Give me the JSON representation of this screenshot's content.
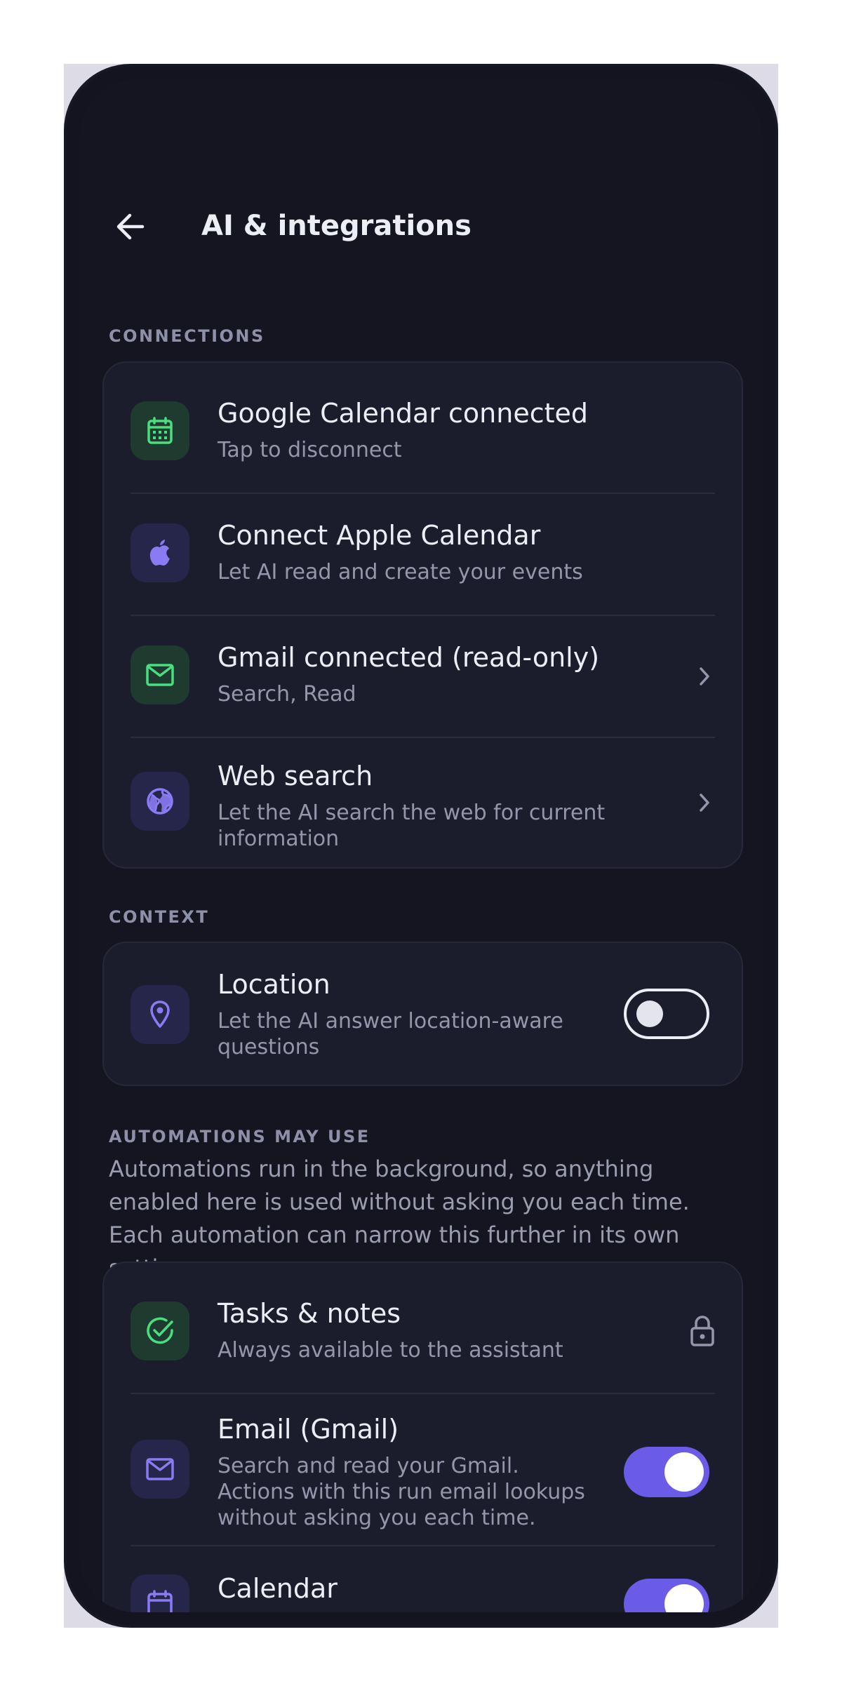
{
  "header": {
    "title": "AI & integrations",
    "back_icon": "arrow-left-icon"
  },
  "sections": {
    "connections": "CONNECTIONS",
    "context": "CONTEXT",
    "automations": "AUTOMATIONS MAY USE"
  },
  "connections": [
    {
      "title": "Google Calendar connected",
      "subtitle": "Tap to disconnect",
      "icon": "calendar-icon"
    },
    {
      "title": "Connect Apple Calendar",
      "subtitle": "Let AI read and create your events",
      "icon": "apple-icon"
    },
    {
      "title": "Gmail connected (read-only)",
      "subtitle": "Search, Read",
      "icon": "mail-icon"
    },
    {
      "title": "Web search",
      "subtitle": "Let the AI search the web for current information",
      "icon": "globe-icon"
    }
  ],
  "context": {
    "title": "Location",
    "subtitle": "Let the AI answer location-aware questions",
    "icon": "location-pin-icon",
    "enabled": false
  },
  "automations_note": "Automations run in the background, so anything enabled here is used without asking you each time. Each automation can narrow this further in its own settings.",
  "automations": [
    {
      "title": "Tasks & notes",
      "subtitle": "Always available to the assistant",
      "icon": "check-circle-icon",
      "locked": true
    },
    {
      "title": "Email (Gmail)",
      "subtitle": "Search and read your Gmail. Actions with this run email lookups without asking you each time.",
      "icon": "mail-icon",
      "enabled": true
    },
    {
      "title": "Calendar",
      "icon": "calendar-icon",
      "enabled": true
    }
  ],
  "colors": {
    "accent": "#6b5ce7",
    "green": "#4ade80",
    "background": "#141521",
    "card": "#1c1d2c"
  }
}
